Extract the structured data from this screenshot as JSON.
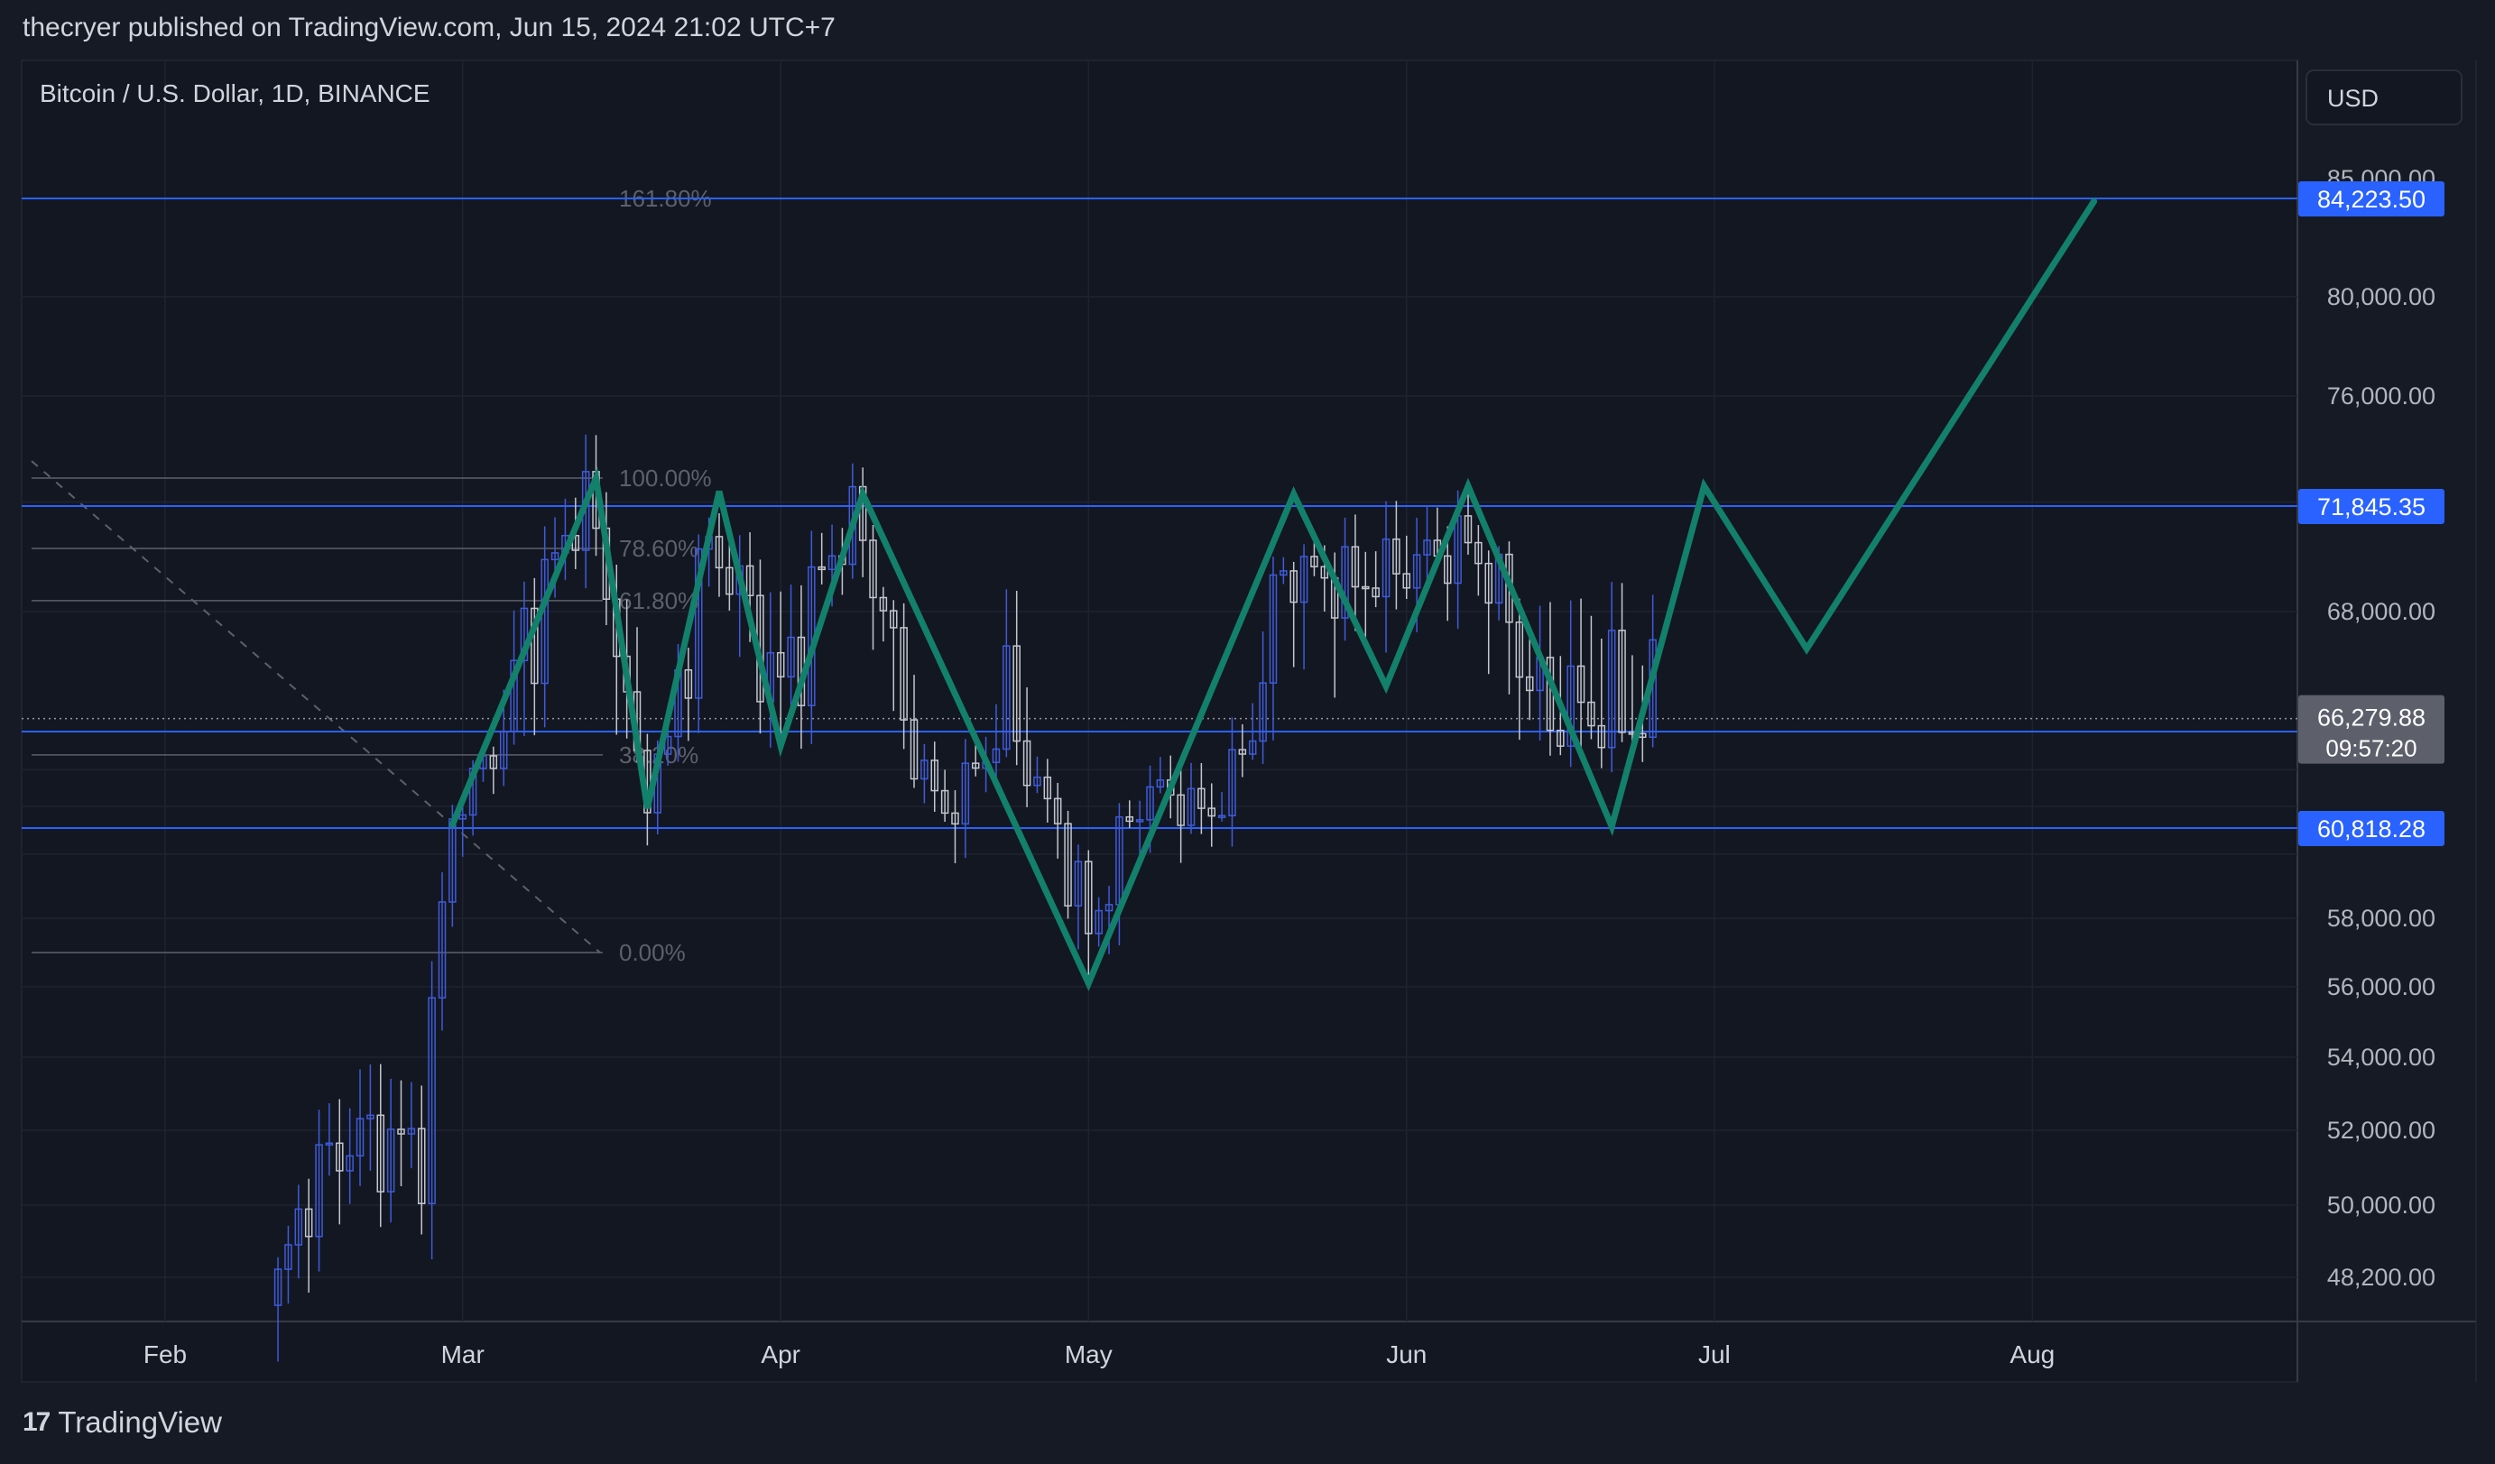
{
  "header": {
    "publish_line": "thecryer published on TradingView.com, Jun 15, 2024 21:02 UTC+7"
  },
  "chart": {
    "symbol_line": "Bitcoin / U.S. Dollar, 1D, BINANCE",
    "currency": "USD",
    "price_ticks": [
      "85,000.00",
      "80,000.00",
      "76,000.00",
      "68,000.00",
      "58,000.00",
      "56,000.00",
      "54,000.00",
      "52,000.00",
      "50,000.00",
      "48,200.00"
    ],
    "time_ticks": [
      "Feb",
      "Mar",
      "Apr",
      "May",
      "Jun",
      "Jul",
      "Aug"
    ],
    "fib_labels": [
      "161.80%",
      "100.00%",
      "78.60%",
      "61.80%",
      "38.20%",
      "0.00%"
    ],
    "price_tags": {
      "level_1": "84,223.50",
      "level_2": "71,845.35",
      "last_price": "66,279.88",
      "countdown": "09:57:20",
      "level_3": "66,071.34",
      "level_4": "60,818.28"
    },
    "colors": {
      "background": "#161a25",
      "level_line": "#2962ff",
      "projection": "#12806b",
      "up_candle": "#3f5bd8",
      "down_candle": "#c3c6ce"
    }
  },
  "chart_data": {
    "type": "line",
    "ylim": [
      47500,
      86500
    ],
    "horizontal_levels": [
      84223.5,
      71845.35,
      66071.34,
      60818.28
    ],
    "last_price": 66279.88,
    "fibonacci": {
      "levels": [
        "161.80%",
        "100.00%",
        "78.60%",
        "61.80%",
        "38.20%",
        "0.00%"
      ],
      "values": [
        84223.5,
        72900,
        70300,
        68400,
        64800,
        57000
      ]
    },
    "projection_path": {
      "x": [
        "2024-02-29",
        "2024-03-14",
        "2024-03-19",
        "2024-03-26",
        "2024-04-01",
        "2024-04-09",
        "2024-05-01",
        "2024-05-21",
        "2024-05-30",
        "2024-06-07",
        "2024-06-21",
        "2024-06-30",
        "2024-07-10",
        "2024-08-07"
      ],
      "y": [
        61000,
        72900,
        61900,
        72400,
        65300,
        72300,
        56100,
        72300,
        66800,
        72600,
        60900,
        72600,
        67400,
        84100
      ]
    },
    "candles_shown": "daily BTCUSD candles from early Feb to mid Jun 2024"
  },
  "footer": {
    "brand": "TradingView"
  }
}
